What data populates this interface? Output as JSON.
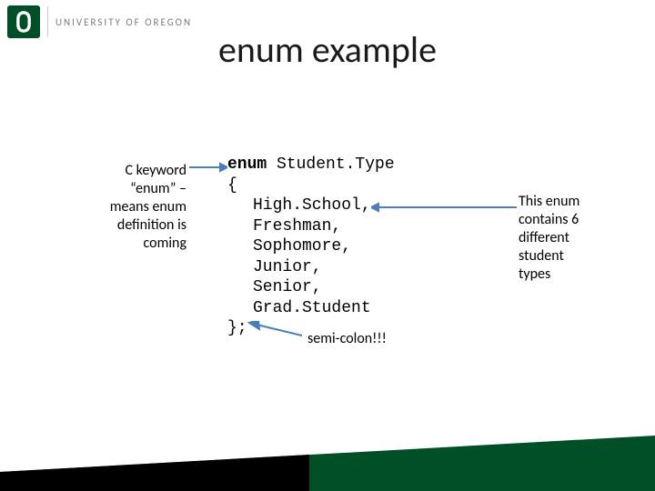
{
  "header": {
    "institution": "UNIVERSITY OF OREGON"
  },
  "title": "enum example",
  "code": {
    "l1a": "enum",
    "l1b": " Student.Type",
    "l2": "{",
    "l3": "High.School,",
    "l4": "Freshman,",
    "l5": "Sophomore,",
    "l6": "Junior,",
    "l7": "Senior,",
    "l8": "Grad.Student",
    "l9": "};"
  },
  "annot": {
    "left_l1": "C keyword",
    "left_l2": "“enum” –",
    "left_l3": "means enum",
    "left_l4": "definition is",
    "left_l5": "coming",
    "right_l1": "This enum",
    "right_l2": "contains 6",
    "right_l3": "different",
    "right_l4": "student",
    "right_l5": "types",
    "bottom": "semi-colon!!!"
  }
}
